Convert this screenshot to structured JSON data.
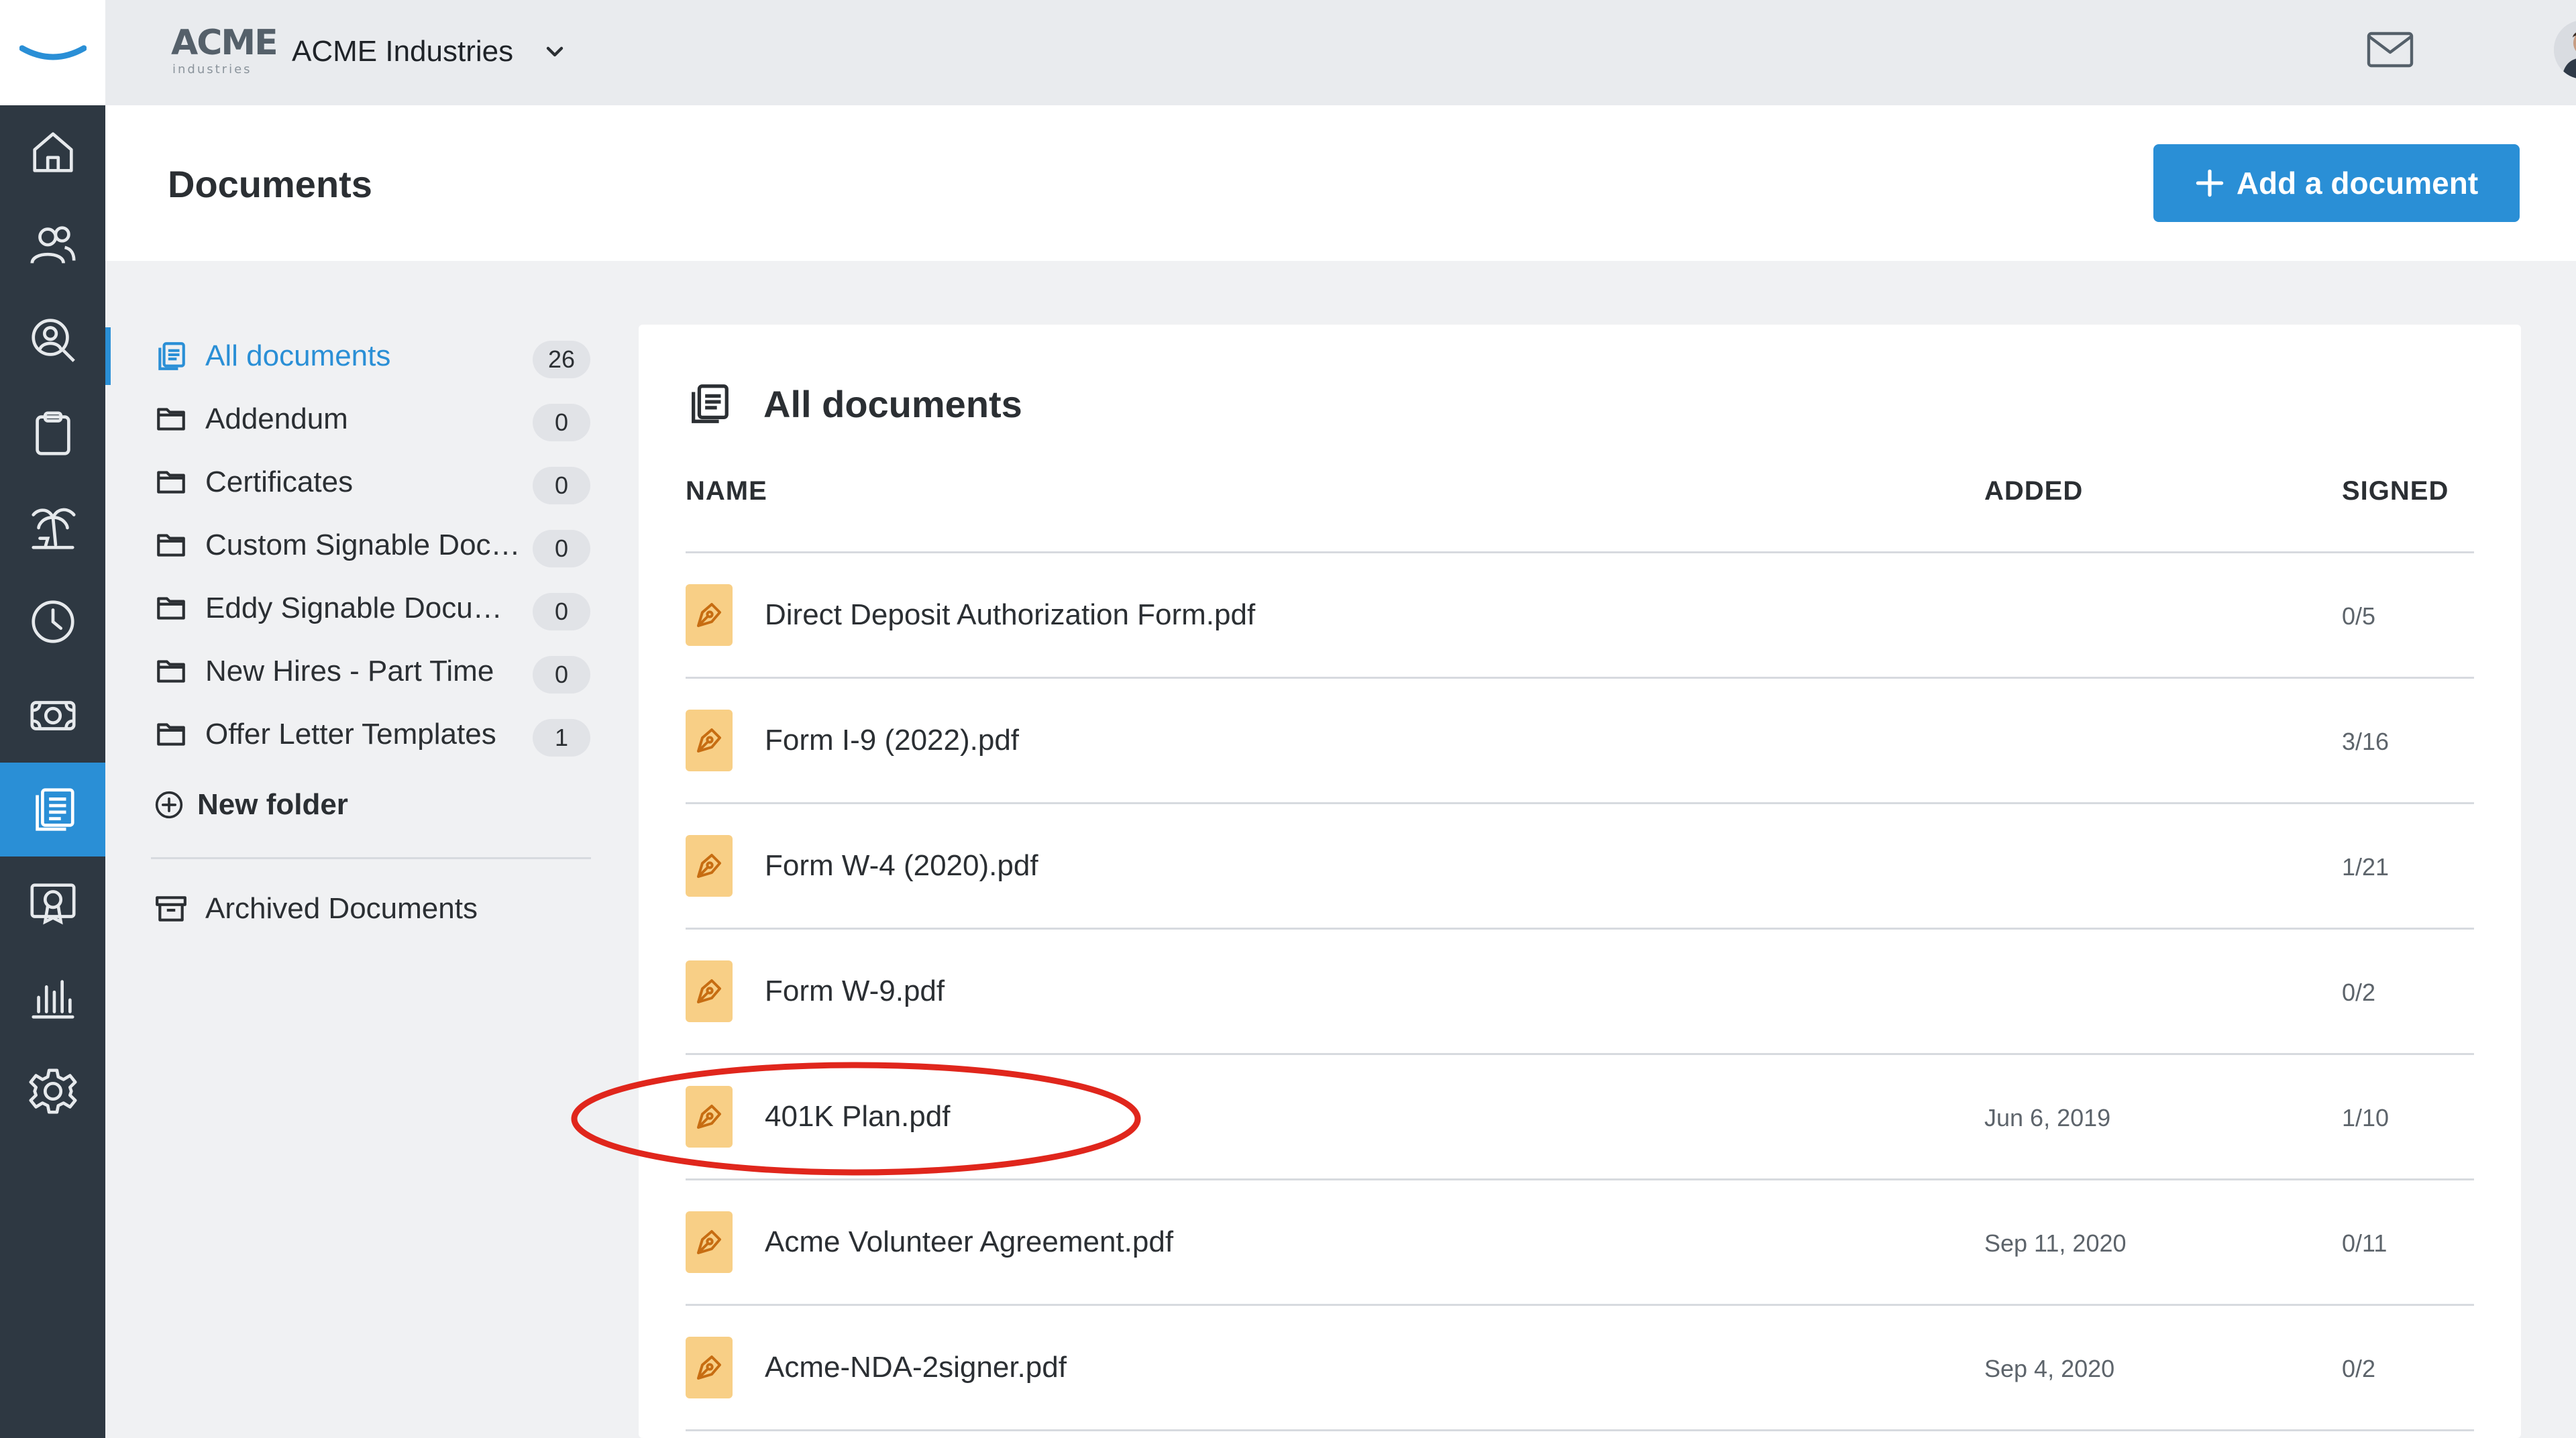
{
  "app": {
    "company_logo_text": "ACME",
    "company_logo_sub": "industries",
    "company_name": "ACME Industries"
  },
  "colors": {
    "accent": "#2a8fd6",
    "rail_bg": "#2e3842",
    "doc_icon_bg": "#f8cf86",
    "annotation": "#e0261c"
  },
  "rail": {
    "items": [
      {
        "icon": "home-icon"
      },
      {
        "icon": "people-icon"
      },
      {
        "icon": "user-search-icon"
      },
      {
        "icon": "clipboard-icon"
      },
      {
        "icon": "palm-tree-icon"
      },
      {
        "icon": "clock-icon"
      },
      {
        "icon": "money-icon"
      },
      {
        "icon": "documents-icon",
        "active": true
      },
      {
        "icon": "certificate-icon"
      },
      {
        "icon": "reports-icon"
      },
      {
        "icon": "gear-icon"
      }
    ]
  },
  "header": {
    "page_title": "Documents",
    "add_button_label": "Add a document"
  },
  "sidebar": {
    "folders": [
      {
        "label": "All documents",
        "count": "26",
        "icon": "documents-icon",
        "active": true
      },
      {
        "label": "Addendum",
        "count": "0",
        "icon": "folder-icon"
      },
      {
        "label": "Certificates",
        "count": "0",
        "icon": "folder-icon"
      },
      {
        "label": "Custom Signable Documents",
        "count": "0",
        "icon": "folder-icon"
      },
      {
        "label": "Eddy Signable Documents",
        "count": "0",
        "icon": "folder-icon"
      },
      {
        "label": "New Hires - Part Time",
        "count": "0",
        "icon": "folder-icon"
      },
      {
        "label": "Offer Letter Templates",
        "count": "1",
        "icon": "folder-icon"
      }
    ],
    "new_folder_label": "New folder",
    "archived_label": "Archived Documents"
  },
  "main": {
    "title": "All documents",
    "columns": {
      "name": "NAME",
      "added": "ADDED",
      "signed": "SIGNED"
    },
    "rows": [
      {
        "name": "Direct Deposit Authorization Form.pdf",
        "added": "",
        "signed": "0/5"
      },
      {
        "name": "Form I-9 (2022).pdf",
        "added": "",
        "signed": "3/16"
      },
      {
        "name": "Form W-4 (2020).pdf",
        "added": "",
        "signed": "1/21"
      },
      {
        "name": "Form W-9.pdf",
        "added": "",
        "signed": "0/2"
      },
      {
        "name": "401K Plan.pdf",
        "added": "Jun 6, 2019",
        "signed": "1/10"
      },
      {
        "name": "Acme Volunteer Agreement.pdf",
        "added": "Sep 11, 2020",
        "signed": "0/11"
      },
      {
        "name": "Acme-NDA-2signer.pdf",
        "added": "Sep 4, 2020",
        "signed": "0/2"
      }
    ]
  }
}
